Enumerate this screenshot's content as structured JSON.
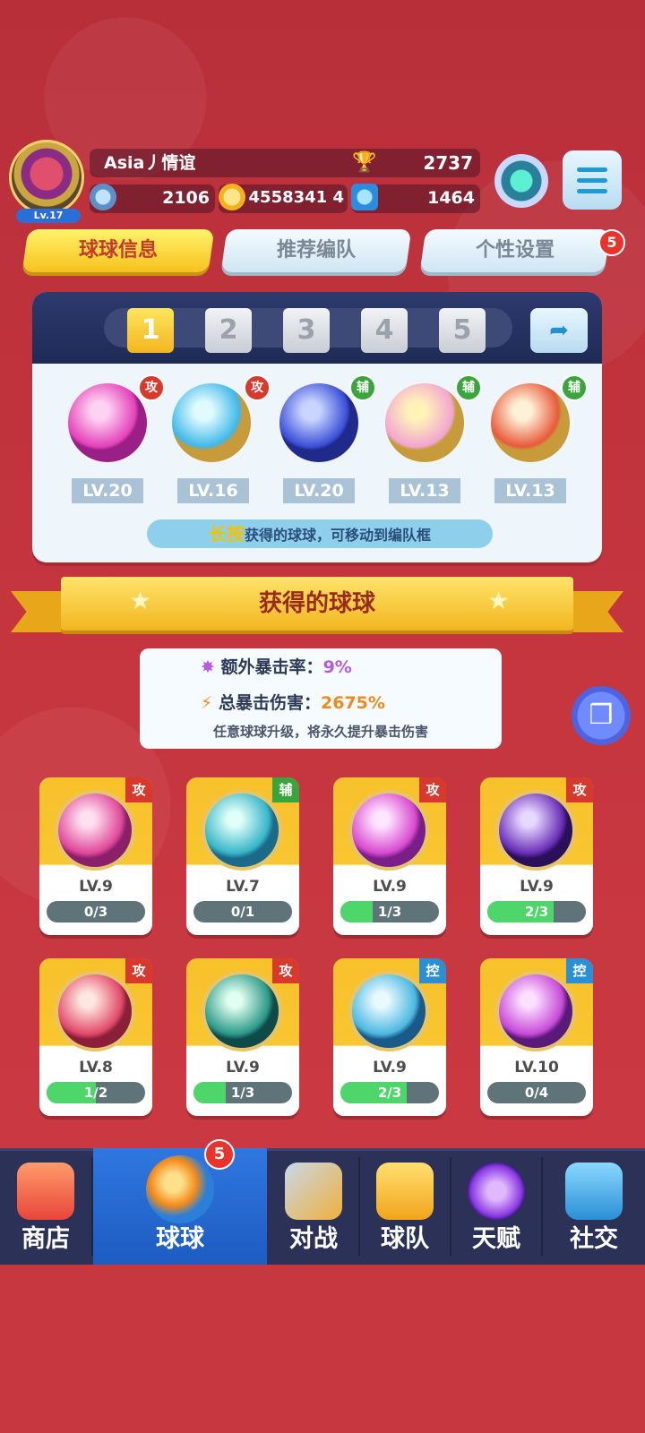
{
  "player": {
    "name": "Asia丿情谊",
    "level": "Lv.17",
    "trophies": "2737",
    "stars": "2106",
    "gold": "4558341 4",
    "gems": "1464"
  },
  "tabs": [
    {
      "label": "球球信息"
    },
    {
      "label": "推荐编队"
    },
    {
      "label": "个性设置",
      "badge": "5"
    }
  ],
  "lineup": {
    "slots": [
      "1",
      "2",
      "3",
      "4",
      "5"
    ],
    "active_slot": "1",
    "balls": [
      {
        "type": "攻",
        "level": "LV.20",
        "color": "#e342b8"
      },
      {
        "type": "攻",
        "level": "LV.16",
        "color": "#3fb8e8"
      },
      {
        "type": "辅",
        "level": "LV.20",
        "color": "#3b4fd8"
      },
      {
        "type": "辅",
        "level": "LV.13",
        "color": "#f2a6d0"
      },
      {
        "type": "辅",
        "level": "LV.13",
        "color": "#e85a3a"
      }
    ],
    "hint_highlight": "长按",
    "hint_text": "获得的球球，可移动到编队框"
  },
  "section_title": "获得的球球",
  "crit": {
    "extra_label": "额外暴击率：",
    "extra_value": "9%",
    "total_label": "总暴击伤害：",
    "total_value": "2675%",
    "note": "任意球球升级，将永久提升暴击伤害"
  },
  "owned_balls": [
    {
      "type": "攻",
      "level": "LV.9",
      "progress": "0/3",
      "fill": 0,
      "color": "#e0489a"
    },
    {
      "type": "辅",
      "level": "LV.7",
      "progress": "0/1",
      "fill": 0,
      "color": "#38b6c9"
    },
    {
      "type": "攻",
      "level": "LV.9",
      "progress": "1/3",
      "fill": 0.33,
      "color": "#d94ad0"
    },
    {
      "type": "攻",
      "level": "LV.9",
      "progress": "2/3",
      "fill": 0.67,
      "color": "#6a2fb8"
    },
    {
      "type": "攻",
      "level": "LV.8",
      "progress": "1/2",
      "fill": 0.5,
      "color": "#e24a6a"
    },
    {
      "type": "攻",
      "level": "LV.9",
      "progress": "1/3",
      "fill": 0.33,
      "color": "#2e9a8a"
    },
    {
      "type": "控",
      "level": "LV.9",
      "progress": "2/3",
      "fill": 0.67,
      "color": "#4cb8e0"
    },
    {
      "type": "控",
      "level": "LV.10",
      "progress": "0/4",
      "fill": 0,
      "color": "#c84ad8"
    }
  ],
  "nav": [
    {
      "label": "商店"
    },
    {
      "label": "球球",
      "badge": "5"
    },
    {
      "label": "对战"
    },
    {
      "label": "球队"
    },
    {
      "label": "天赋"
    },
    {
      "label": "社交"
    }
  ]
}
